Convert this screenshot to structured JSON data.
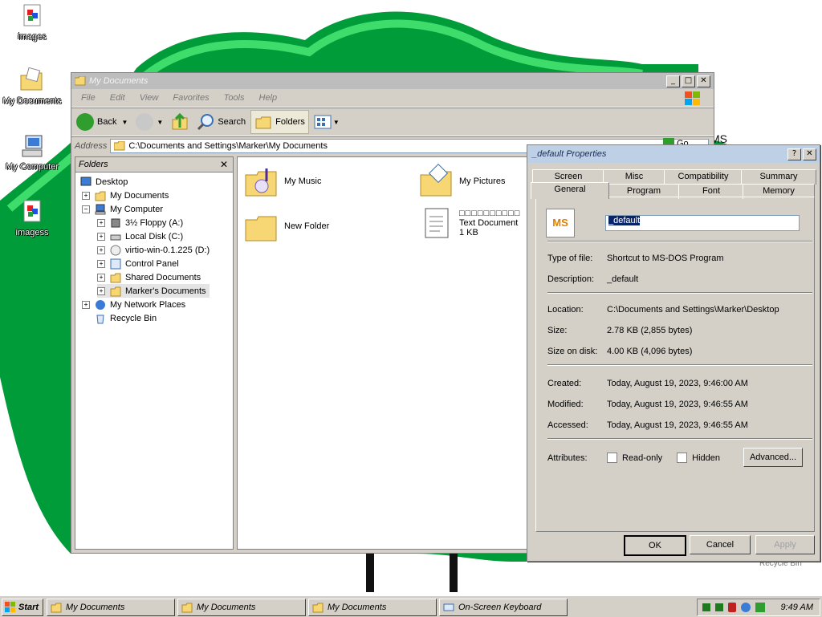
{
  "desktop": {
    "icons": [
      {
        "label": "images",
        "icon": "image-file-icon"
      },
      {
        "label": "My Documents",
        "icon": "my-documents-icon"
      },
      {
        "label": "My Computer",
        "icon": "my-computer-icon"
      },
      {
        "label": "imagess",
        "icon": "image-file-icon"
      }
    ],
    "obscured_icon_label": "MS",
    "recycle_label": "Recycle Bin",
    "colors": {
      "green_dark": "#009c39",
      "green_light": "#22c55e",
      "black": "#000000"
    }
  },
  "explorer": {
    "title": "My Documents",
    "menu": [
      "File",
      "Edit",
      "View",
      "Favorites",
      "Tools",
      "Help"
    ],
    "toolbar": {
      "back": "Back",
      "search": "Search",
      "folders": "Folders"
    },
    "address_label": "Address",
    "address_value": "C:\\Documents and Settings\\Marker\\My Documents",
    "go_label": "Go",
    "folders_pane_title": "Folders",
    "tree": [
      {
        "label": "Desktop",
        "icon": "desktop-icon"
      },
      {
        "label": "My Documents",
        "icon": "my-documents-icon"
      },
      {
        "label": "My Computer",
        "icon": "my-computer-icon"
      },
      {
        "label": "3½ Floppy (A:)",
        "icon": "floppy-icon"
      },
      {
        "label": "Local Disk (C:)",
        "icon": "hard-drive-icon"
      },
      {
        "label": "virtio-win-0.1.225 (D:)",
        "icon": "cd-drive-icon"
      },
      {
        "label": "Control Panel",
        "icon": "control-panel-icon"
      },
      {
        "label": "Shared Documents",
        "icon": "folder-icon"
      },
      {
        "label": "Marker's Documents",
        "icon": "folder-icon"
      },
      {
        "label": "My Network Places",
        "icon": "network-icon"
      },
      {
        "label": "Recycle Bin",
        "icon": "recycle-bin-icon"
      }
    ],
    "files": [
      {
        "name": "My Music",
        "icon": "music-folder-icon"
      },
      {
        "name": "My Pictures",
        "icon": "pictures-folder-icon"
      },
      {
        "name": "New Folder",
        "icon": "folder-icon"
      },
      {
        "name": "□□□□□□□□□□",
        "sub": "Text Document",
        "size": "1 KB",
        "icon": "text-document-icon"
      }
    ]
  },
  "props": {
    "title": "_default Properties",
    "tabs_back": [
      "Screen",
      "Misc",
      "Compatibility",
      "Summary"
    ],
    "tabs_front": [
      "General",
      "Program",
      "Font",
      "Memory"
    ],
    "icon_text": "MS",
    "name_value": "_default",
    "rows": [
      {
        "k": "Type of file:",
        "v": "Shortcut to MS-DOS Program"
      },
      {
        "k": "Description:",
        "v": "_default"
      },
      {
        "k": "Location:",
        "v": "C:\\Documents and Settings\\Marker\\Desktop"
      },
      {
        "k": "Size:",
        "v": "2.78 KB (2,855 bytes)"
      },
      {
        "k": "Size on disk:",
        "v": "4.00 KB (4,096 bytes)"
      },
      {
        "k": "Created:",
        "v": "Today, August 19, 2023, 9:46:00 AM"
      },
      {
        "k": "Modified:",
        "v": "Today, August 19, 2023, 9:46:55 AM"
      },
      {
        "k": "Accessed:",
        "v": "Today, August 19, 2023, 9:46:55 AM"
      }
    ],
    "attributes_label": "Attributes:",
    "readonly": "Read-only",
    "hidden": "Hidden",
    "advanced": "Advanced...",
    "ok": "OK",
    "cancel": "Cancel",
    "apply": "Apply"
  },
  "taskbar": {
    "start": "Start",
    "tasks": [
      {
        "label": "My Documents",
        "icon": "folder-icon"
      },
      {
        "label": "My Documents",
        "icon": "folder-icon"
      },
      {
        "label": "My Documents",
        "icon": "folder-icon"
      },
      {
        "label": "On-Screen Keyboard",
        "icon": "keyboard-icon"
      }
    ],
    "clock": "9:49 AM"
  }
}
